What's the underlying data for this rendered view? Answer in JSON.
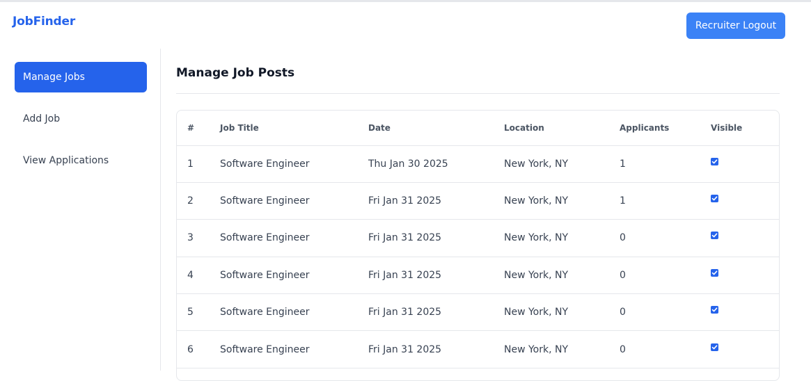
{
  "app": {
    "logo": "JobFinder",
    "logout_label": "Recruiter Logout"
  },
  "sidebar": {
    "items": [
      {
        "label": "Manage Jobs",
        "active": true
      },
      {
        "label": "Add Job",
        "active": false
      },
      {
        "label": "View Applications",
        "active": false
      }
    ]
  },
  "main": {
    "title": "Manage Job Posts",
    "table": {
      "headers": [
        "#",
        "Job Title",
        "Date",
        "Location",
        "Applicants",
        "Visible"
      ],
      "rows": [
        {
          "num": "1",
          "title": "Software Engineer",
          "date": "Thu Jan 30 2025",
          "location": "New York, NY",
          "applicants": "1",
          "visible": true
        },
        {
          "num": "2",
          "title": "Software Engineer",
          "date": "Fri Jan 31 2025",
          "location": "New York, NY",
          "applicants": "1",
          "visible": true
        },
        {
          "num": "3",
          "title": "Software Engineer",
          "date": "Fri Jan 31 2025",
          "location": "New York, NY",
          "applicants": "0",
          "visible": true
        },
        {
          "num": "4",
          "title": "Software Engineer",
          "date": "Fri Jan 31 2025",
          "location": "New York, NY",
          "applicants": "0",
          "visible": true
        },
        {
          "num": "5",
          "title": "Software Engineer",
          "date": "Fri Jan 31 2025",
          "location": "New York, NY",
          "applicants": "0",
          "visible": true
        },
        {
          "num": "6",
          "title": "Software Engineer",
          "date": "Fri Jan 31 2025",
          "location": "New York, NY",
          "applicants": "0",
          "visible": true
        }
      ]
    }
  },
  "colors": {
    "brand": "#2563eb",
    "button": "#3b82f6",
    "border": "#e5e7eb"
  }
}
